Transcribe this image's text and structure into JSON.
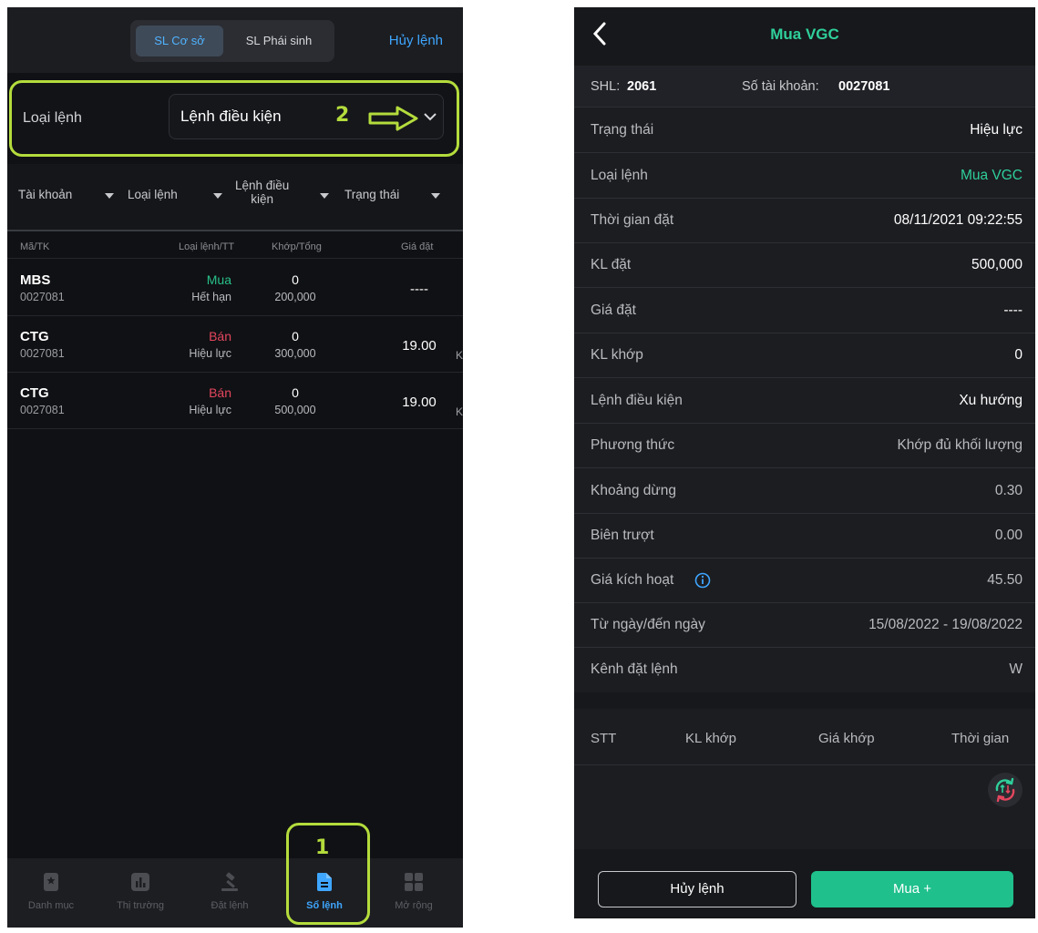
{
  "left": {
    "segment": {
      "active": "SL Cơ sở",
      "inactive": "SL Phái sinh"
    },
    "cancel_label": "Hủy lệnh",
    "order_type": {
      "label": "Loại lệnh",
      "value": "Lệnh điều kiện"
    },
    "annotations": {
      "step1": "1",
      "step2": "2"
    },
    "filters": {
      "account": "Tài khoản",
      "order_type": "Loại lệnh",
      "condition_line1": "Lệnh điều",
      "condition_line2": "kiện",
      "status": "Trạng thái"
    },
    "columns": {
      "symbol": "Mã/TK",
      "type_status": "Loại lệnh/TT",
      "matched_total": "Khớp/Tổng",
      "price": "Giá đặt"
    },
    "orders": [
      {
        "symbol": "MBS",
        "account": "0027081",
        "side": "Mua",
        "status": "Hết hạn",
        "matched": "0",
        "total": "200,000",
        "price": "----",
        "extra": ""
      },
      {
        "symbol": "CTG",
        "account": "0027081",
        "side": "Bán",
        "status": "Hiệu lực",
        "matched": "0",
        "total": "300,000",
        "price": "19.00",
        "extra": "K"
      },
      {
        "symbol": "CTG",
        "account": "0027081",
        "side": "Bán",
        "status": "Hiệu lực",
        "matched": "0",
        "total": "500,000",
        "price": "19.00",
        "extra": "K"
      }
    ],
    "tabs": [
      {
        "label": "Danh mục",
        "icon": "bookmark-icon"
      },
      {
        "label": "Thị trường",
        "icon": "chart-icon"
      },
      {
        "label": "Đặt lệnh",
        "icon": "gavel-icon"
      },
      {
        "label": "Sổ lệnh",
        "icon": "document-icon",
        "active": true
      },
      {
        "label": "Mở rộng",
        "icon": "grid-icon"
      }
    ],
    "colors": {
      "accent": "#3ea6ff",
      "buy": "#27c089",
      "sell": "#e3465e",
      "highlight": "#b4dc3c"
    }
  },
  "right": {
    "title": "Mua VGC",
    "shl_label": "SHL:",
    "shl_value": "2061",
    "account_label": "Số tài khoản:",
    "account_value": "0027081",
    "details": [
      {
        "label": "Trạng thái",
        "value": "Hiệu lực"
      },
      {
        "label": "Loại lệnh",
        "value": "Mua VGC"
      },
      {
        "label": "Thời gian đặt",
        "value": "08/11/2021 09:22:55"
      },
      {
        "label": "KL đặt",
        "value": "500,000"
      },
      {
        "label": "Giá đặt",
        "value": "----"
      },
      {
        "label": "KL khớp",
        "value": "0"
      },
      {
        "label": "Lệnh điều kiện",
        "value": "Xu hướng"
      },
      {
        "label": "Phương thức",
        "value": "Khớp đủ khối lượng"
      },
      {
        "label": "Khoảng dừng",
        "value": "0.30"
      },
      {
        "label": "Biên trượt",
        "value": "0.00"
      },
      {
        "label": "Giá kích hoạt",
        "value": "45.50"
      },
      {
        "label": "Từ ngày/đến ngày",
        "value": "15/08/2022 - 19/08/2022"
      },
      {
        "label": "Kênh đặt lệnh",
        "value": "W"
      }
    ],
    "match_columns": {
      "stt": "STT",
      "volume": "KL khớp",
      "price": "Giá khớp",
      "time": "Thời gian"
    },
    "buttons": {
      "cancel": "Hủy lệnh",
      "buy": "Mua +"
    },
    "colors": {
      "green": "#2fcf9a",
      "buy_button": "#1fc08c"
    }
  }
}
